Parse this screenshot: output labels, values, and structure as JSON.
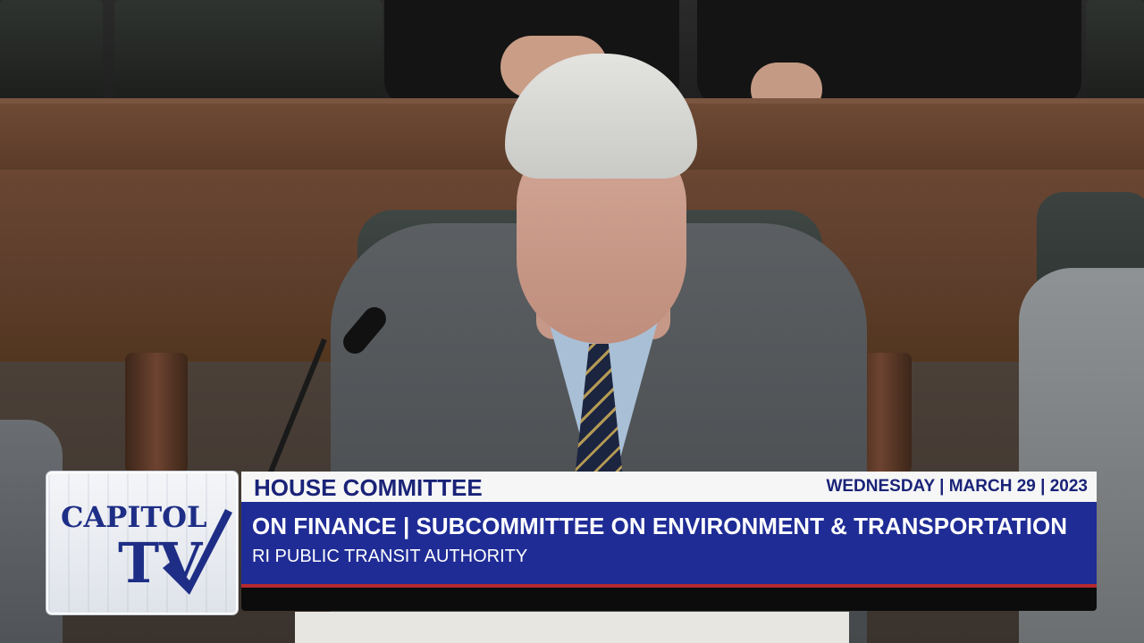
{
  "lower_third": {
    "logo": {
      "line1": "CAPITOL",
      "line2": "TV"
    },
    "title": "HOUSE COMMITTEE",
    "date": "WEDNESDAY | MARCH 29 | 2023",
    "subtitle": "ON FINANCE | SUBCOMMITTEE ON ENVIRONMENT & TRANSPORTATION",
    "topic": "RI PUBLIC TRANSIT AUTHORITY"
  },
  "colors": {
    "banner_blue": "#1f2c96",
    "title_blue": "#1a2378",
    "accent_red": "#b5292d"
  }
}
